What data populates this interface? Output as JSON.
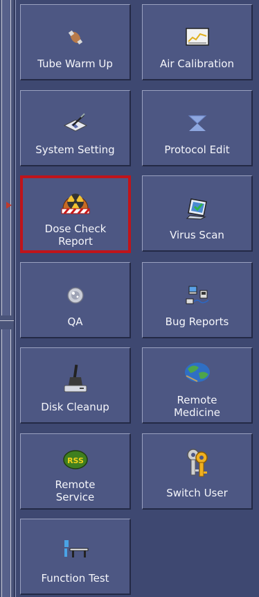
{
  "tiles": [
    {
      "id": "tube-warm-up",
      "label": "Tube Warm Up",
      "icon": "hand-tool-icon"
    },
    {
      "id": "air-calibration",
      "label": "Air Calibration",
      "icon": "chart-monitor-icon"
    },
    {
      "id": "system-setting",
      "label": "System Setting",
      "icon": "pen-paper-icon"
    },
    {
      "id": "protocol-edit",
      "label": "Protocol Edit",
      "icon": "hourglass-icon"
    },
    {
      "id": "dose-check-report",
      "label_line1": "Dose Check",
      "label_line2": "Report",
      "icon": "radiation-icon",
      "selected": true
    },
    {
      "id": "virus-scan",
      "label": "Virus Scan",
      "icon": "shield-screen-icon"
    },
    {
      "id": "qa",
      "label": "QA",
      "icon": "phantom-disc-icon"
    },
    {
      "id": "bug-reports",
      "label": "Bug Reports",
      "icon": "network-computers-icon"
    },
    {
      "id": "disk-cleanup",
      "label": "Disk Cleanup",
      "icon": "broom-drive-icon"
    },
    {
      "id": "remote-medicine",
      "label_line1": "Remote",
      "label_line2": "Medicine",
      "icon": "globe-icon"
    },
    {
      "id": "remote-service",
      "label_line1": "Remote",
      "label_line2": "Service",
      "icon": "rss-icon"
    },
    {
      "id": "switch-user",
      "label": "Switch User",
      "icon": "keys-icon"
    },
    {
      "id": "function-test",
      "label": "Function Test",
      "icon": "table-tool-icon"
    }
  ],
  "colors": {
    "accent": "#c0141a",
    "panel": "#4d5783",
    "background": "#3e4871"
  }
}
